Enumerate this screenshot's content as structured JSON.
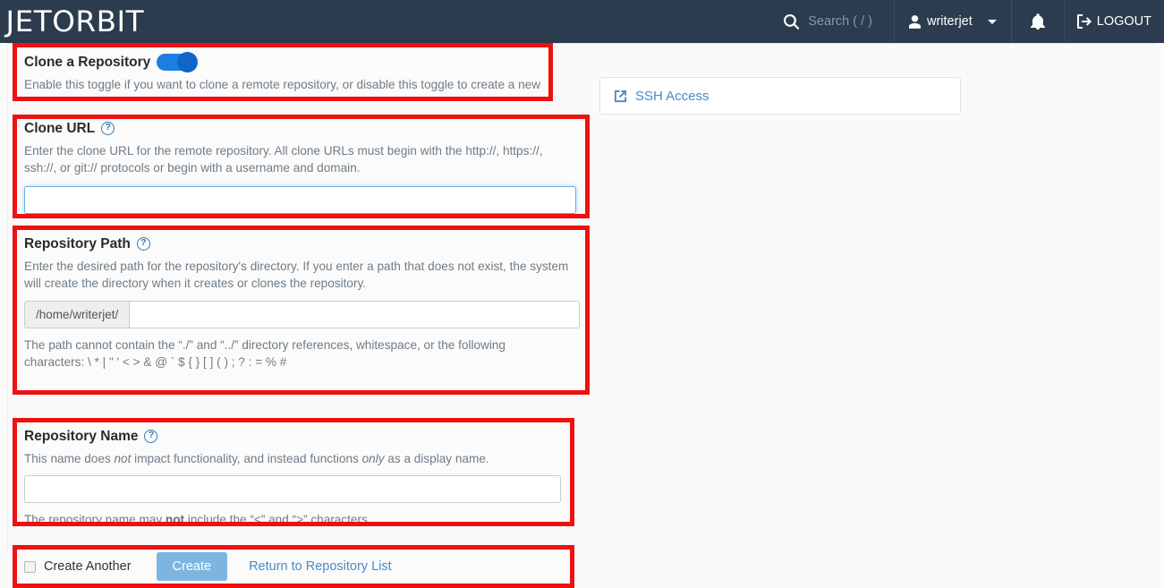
{
  "header": {
    "logo": "JETORBIT",
    "search": {
      "placeholder": "Search ( / )",
      "icon": "search-icon"
    },
    "user": {
      "name": "writerjet",
      "icon": "user-icon",
      "caret": "chevron-down-icon"
    },
    "notifications_icon": "bell-icon",
    "logout": {
      "label": "LOGOUT",
      "icon": "sign-out-icon"
    },
    "background_color": "#2b3c4e"
  },
  "sections": {
    "clone_toggle": {
      "title": "Clone a Repository",
      "description": "Enable this toggle if you want to clone a remote repository, or disable this toggle to create a new repository.",
      "toggle_on": true,
      "toggle_color": "#1a7fe0"
    },
    "clone_url": {
      "title": "Clone URL",
      "help_icon": "question-circle-icon",
      "description": "Enter the clone URL for the remote repository. All clone URLs must begin with the http://, https://, ssh://, or git:// protocols or begin with a username and domain.",
      "input_value": "",
      "focused": true
    },
    "repository_path": {
      "title": "Repository Path",
      "help_icon": "question-circle-icon",
      "description": "Enter the desired path for the repository's directory. If you enter a path that does not exist, the system will create the directory when it creates or clones the repository.",
      "prefix": "/home/writerjet/",
      "input_value": "",
      "note": "The path cannot contain the “./” and “../” directory references, whitespace, or the following characters: \\ * | \" ' < > & @ ` $ { } [ ] ( ) ; ? : = % #"
    },
    "repository_name": {
      "title": "Repository Name",
      "help_icon": "question-circle-icon",
      "description_parts": {
        "a": "This name does ",
        "em1": "not",
        "b": " impact functionality, and instead functions ",
        "em2": "only",
        "c": " as a display name."
      },
      "input_value": "",
      "note_parts": {
        "a": "The repository name may ",
        "strong": "not",
        "b": " include the “<” and “>” characters."
      }
    },
    "actions": {
      "create_another_label": "Create Another",
      "create_another_checked": false,
      "create_button": "Create",
      "create_button_color": "#7cb6e0",
      "return_link": "Return to Repository List"
    }
  },
  "right_panel": {
    "ssh_access": {
      "label": "SSH Access",
      "icon": "external-link-icon",
      "color": "#4a89c4"
    }
  },
  "annotations": {
    "highlight_color": "#ee1111",
    "boxes": 5
  }
}
